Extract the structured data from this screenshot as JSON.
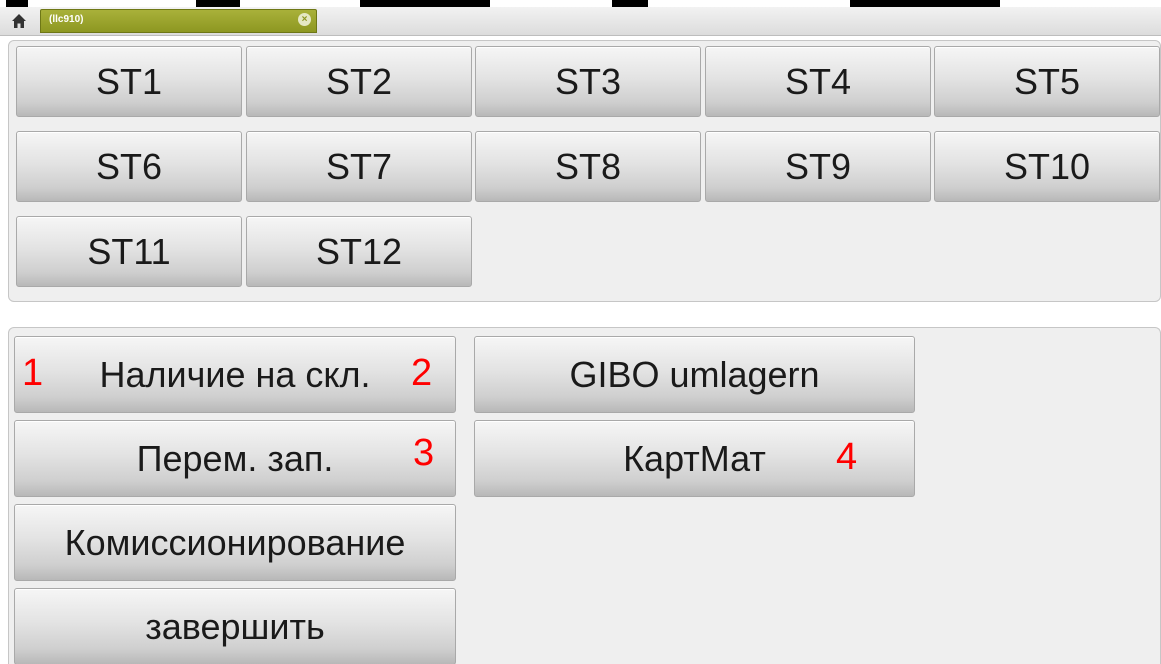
{
  "tabbar": {
    "home_icon": "home-icon",
    "tab_label": "(llc910)",
    "tab_close_icon": "close-icon",
    "tab_close_glyph": "×"
  },
  "stations": [
    "ST1",
    "ST2",
    "ST3",
    "ST4",
    "ST5",
    "ST6",
    "ST7",
    "ST8",
    "ST9",
    "ST10",
    "ST11",
    "ST12"
  ],
  "actions": {
    "stock_label": "Наличие на скл.",
    "transfer_label": "Перем. зап.",
    "commission_label": "Комиссионирование",
    "finish_label": "завершить",
    "gibo_label": "GIBO umlagern",
    "material_card_label": "КартМат"
  },
  "annotations": {
    "n1": "1",
    "n2": "2",
    "n3": "3",
    "n4": "4",
    "color": "#ff0000"
  },
  "colors": {
    "tab_accent": "#9aa22c",
    "panel_bg": "#efefef"
  }
}
